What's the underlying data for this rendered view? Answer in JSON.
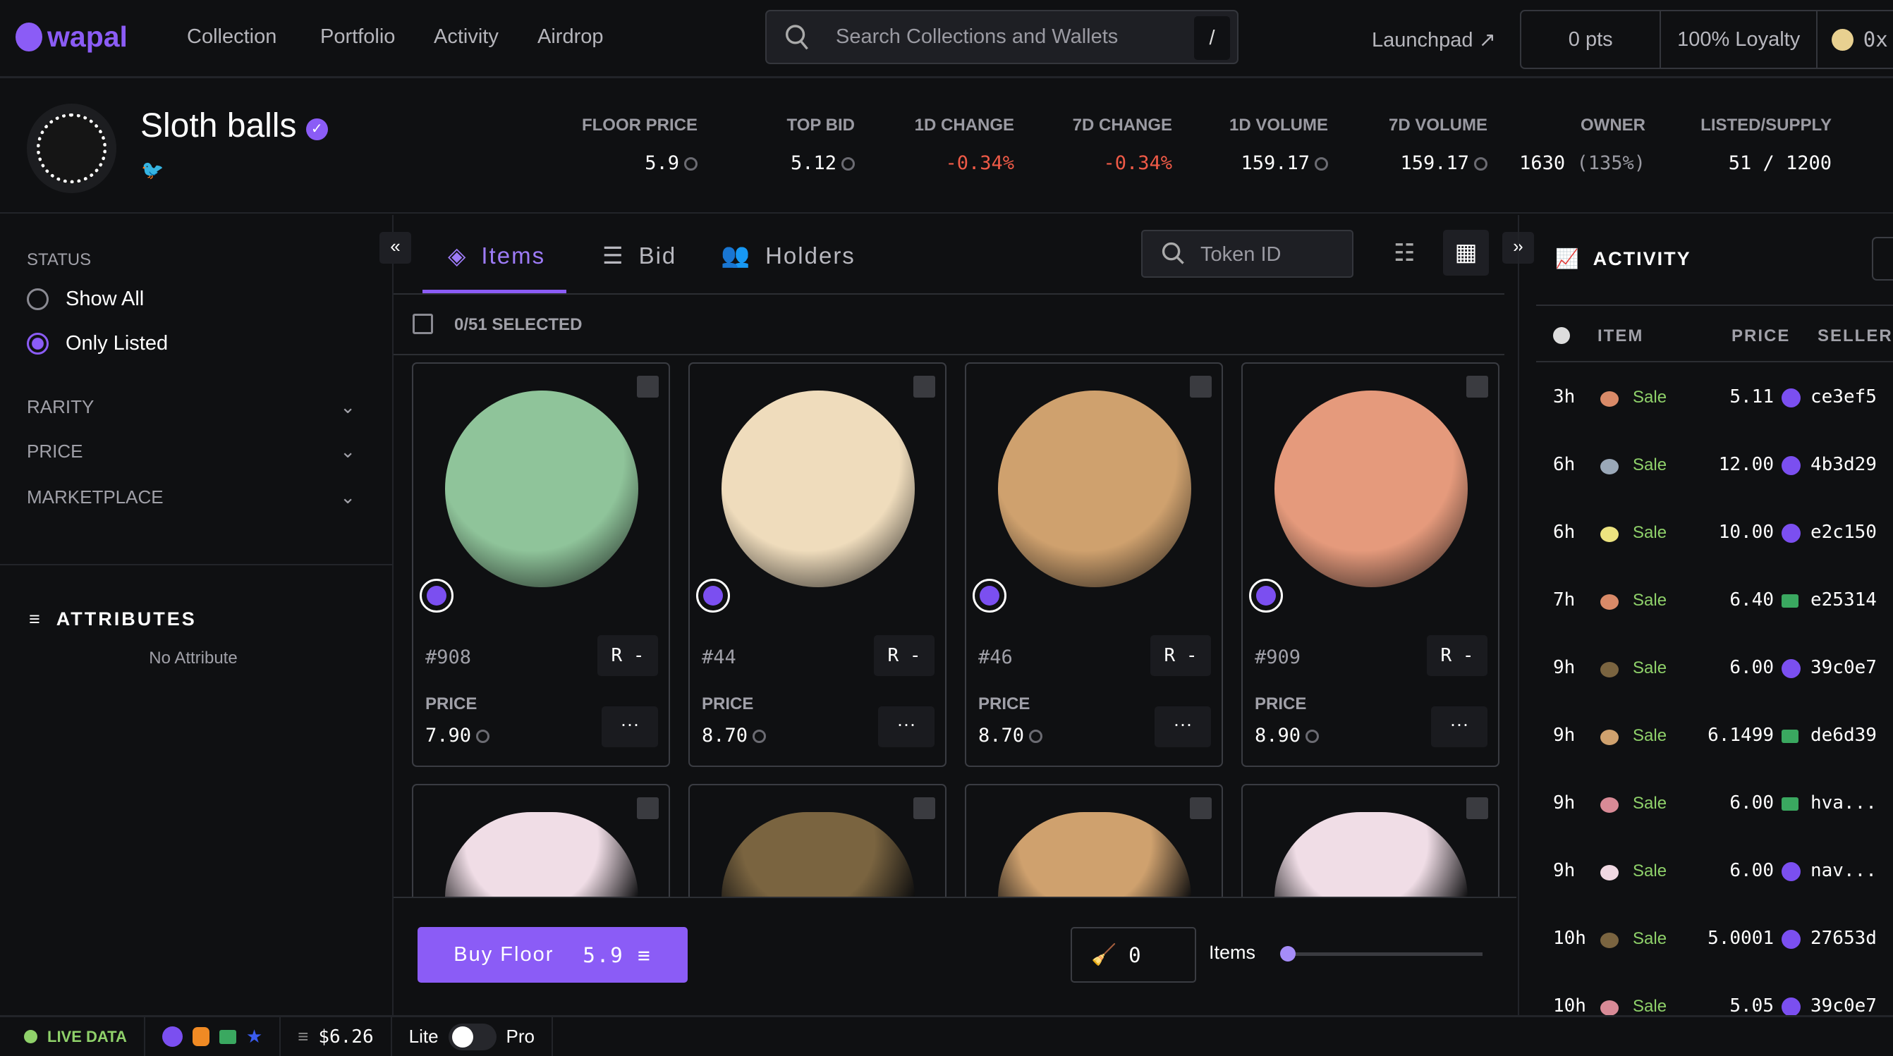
{
  "nav": {
    "logo": "wapal",
    "links": [
      "Collection",
      "Portfolio",
      "Activity",
      "Airdrop"
    ],
    "search_placeholder": "Search Collections and Wallets",
    "search_shortcut": "/",
    "launchpad": "Launchpad",
    "points": "0 pts",
    "loyalty": "100% Loyalty",
    "wallet": "0x"
  },
  "collection": {
    "name": "Sloth balls",
    "verified": true,
    "stats": [
      {
        "label": "FLOOR PRICE",
        "value": "5.9"
      },
      {
        "label": "TOP BID",
        "value": "5.12"
      },
      {
        "label": "1D CHANGE",
        "value": "-0.34%"
      },
      {
        "label": "7D CHANGE",
        "value": "-0.34%"
      },
      {
        "label": "1D VOLUME",
        "value": "159.17"
      },
      {
        "label": "7D VOLUME",
        "value": "159.17"
      },
      {
        "label": "OWNER",
        "value": "1630",
        "extra": "(135%)"
      },
      {
        "label": "LISTED/SUPPLY",
        "value": "51 / 1200"
      }
    ]
  },
  "sidebar": {
    "status_label": "STATUS",
    "options": [
      "Show All",
      "Only Listed"
    ],
    "selected": "Only Listed",
    "filters": [
      "RARITY",
      "PRICE",
      "MARKETPLACE"
    ],
    "attributes_label": "ATTRIBUTES",
    "no_attribute": "No Attribute"
  },
  "tabs": [
    {
      "label": "Items",
      "active": true
    },
    {
      "label": "Bid"
    },
    {
      "label": "Holders"
    }
  ],
  "token_search_placeholder": "Token ID",
  "selected_text": "0/51 SELECTED",
  "items": [
    {
      "id": "#908",
      "rank": "R -",
      "price_label": "PRICE",
      "price": "7.90",
      "color": "#8fc49a"
    },
    {
      "id": "#44",
      "rank": "R -",
      "price_label": "PRICE",
      "price": "8.70",
      "color": "#efdcbc"
    },
    {
      "id": "#46",
      "rank": "R -",
      "price_label": "PRICE",
      "price": "8.70",
      "color": "#cfa16e"
    },
    {
      "id": "#909",
      "rank": "R -",
      "price_label": "PRICE",
      "price": "8.90",
      "color": "#e59a7c"
    },
    {
      "color": "#f0dde6"
    },
    {
      "color": "#7a6440"
    },
    {
      "color": "#cfa16e"
    },
    {
      "color": "#f0dde6"
    }
  ],
  "bottom": {
    "buy_floor": "Buy Floor",
    "buy_floor_price": "5.9",
    "sweep_count": "0",
    "items_label": "Items",
    "sweep_slider": 0
  },
  "activity": {
    "title": "ACTIVITY",
    "columns": [
      "ITEM",
      "PRICE",
      "SELLER"
    ],
    "rows": [
      {
        "time": "3h",
        "type": "Sale",
        "price": "5.11",
        "market": "wapal",
        "seller": "ce3ef5",
        "color": "#d98a68"
      },
      {
        "time": "6h",
        "type": "Sale",
        "price": "12.00",
        "market": "wapal",
        "seller": "4b3d29",
        "color": "#9aa8b8"
      },
      {
        "time": "6h",
        "type": "Sale",
        "price": "10.00",
        "market": "wapal",
        "seller": "e2c150",
        "color": "#ece380"
      },
      {
        "time": "7h",
        "type": "Sale",
        "price": "6.40",
        "market": "mercato",
        "seller": "e25314",
        "color": "#d98a68"
      },
      {
        "time": "9h",
        "type": "Sale",
        "price": "6.00",
        "market": "wapal",
        "seller": "39c0e7",
        "color": "#7a6440"
      },
      {
        "time": "9h",
        "type": "Sale",
        "price": "6.1499",
        "market": "mercato",
        "seller": "de6d39",
        "color": "#cfa16e"
      },
      {
        "time": "9h",
        "type": "Sale",
        "price": "6.00",
        "market": "mercato",
        "seller": "hva...",
        "color": "#d88a96"
      },
      {
        "time": "9h",
        "type": "Sale",
        "price": "6.00",
        "market": "wapal",
        "seller": "nav...",
        "color": "#f0d8e2"
      },
      {
        "time": "10h",
        "type": "Sale",
        "price": "5.0001",
        "market": "wapal",
        "seller": "27653d",
        "color": "#7a6440"
      },
      {
        "time": "10h",
        "type": "Sale",
        "price": "5.05",
        "market": "wapal",
        "seller": "39c0e7",
        "color": "#d88a96"
      }
    ]
  },
  "footer": {
    "live": "LIVE DATA",
    "apt_price": "$6.26",
    "lite": "Lite",
    "pro": "Pro"
  },
  "colors": {
    "accent": "#8b5cf6",
    "negative": "#ef5a47",
    "sale": "#8fd16a"
  }
}
